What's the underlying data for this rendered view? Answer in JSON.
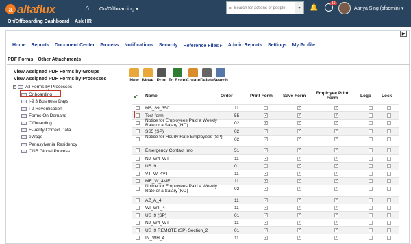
{
  "brand": "altaflux",
  "topbar": {
    "module": "On/Offboarding",
    "search_placeholder": "Search for actions or people",
    "notif_count": "16",
    "user": "Aanya Sing (sfadmin)"
  },
  "secondary": [
    "On/Offboarding Dashboard",
    "Ask HR"
  ],
  "mainnav": [
    "Home",
    "Reports",
    "Document Center",
    "Process",
    "Notifications",
    "Security",
    "Reference Files ▸",
    "Admin Reports",
    "Settings",
    "My Profile"
  ],
  "subtabs": [
    "PDF Forms",
    "Other Attachments"
  ],
  "left": {
    "group_title": "View Assigned PDF Forms by Groups",
    "process_title": "View Assigned PDF Forms by Processes",
    "root": "All Forms by Processes",
    "items": [
      "Onboarding",
      "I-9 3 Business Days",
      "I-9 Reverification",
      "Forms On Demand",
      "Offboarding",
      "E-Verify Correct Data",
      "eWage",
      "Pennsylvania Residency",
      "ONB Global Process"
    ]
  },
  "toolbar": [
    {
      "label": "New",
      "icon": "folder-new-icon",
      "color": "#e8a83a"
    },
    {
      "label": "Move",
      "icon": "folder-move-icon",
      "color": "#e8a83a"
    },
    {
      "label": "Print",
      "icon": "printer-icon",
      "color": "#555555"
    },
    {
      "label": "To Excel",
      "icon": "excel-icon",
      "color": "#2e7d32"
    },
    {
      "label": "Create",
      "icon": "create-doc-icon",
      "color": "#d98c2b"
    },
    {
      "label": "Delete",
      "icon": "delete-icon",
      "color": "#666666"
    },
    {
      "label": "Search",
      "icon": "search-doc-icon",
      "color": "#5577aa"
    }
  ],
  "columns": {
    "name": "Name",
    "order": "Order",
    "print": "Print Form",
    "save": "Save Form",
    "emp_print": "Employee Print Form",
    "logo": "Logo",
    "lock": "Lock"
  },
  "rows": [
    {
      "name": "MS_89_350",
      "order": "11",
      "print": false,
      "save": true,
      "emp": true,
      "logo": false,
      "lock": false
    },
    {
      "name": "Test form",
      "order": "55",
      "print": true,
      "save": true,
      "emp": true,
      "logo": false,
      "lock": false
    },
    {
      "name": "Notice for Employees Paid a Weekly Rate or a Salary (HC)",
      "order": "02",
      "print": true,
      "save": true,
      "emp": true,
      "logo": false,
      "lock": false
    },
    {
      "name": "SS5 (SP)",
      "order": "02",
      "print": true,
      "save": true,
      "emp": true,
      "logo": false,
      "lock": false
    },
    {
      "name": "Notice for Hourly Rate Employees (SP)",
      "order": "02",
      "print": true,
      "save": true,
      "emp": true,
      "logo": false,
      "lock": false
    },
    {
      "name": "Emergency Contact Info",
      "order": "51",
      "print": true,
      "save": true,
      "emp": true,
      "logo": false,
      "lock": false
    },
    {
      "name": "NJ_W4_WT",
      "order": "11",
      "print": true,
      "save": true,
      "emp": true,
      "logo": false,
      "lock": false
    },
    {
      "name": "US I9",
      "order": "01",
      "print": false,
      "save": true,
      "emp": true,
      "logo": false,
      "lock": false
    },
    {
      "name": "VT_W_4VT",
      "order": "11",
      "print": true,
      "save": true,
      "emp": true,
      "logo": false,
      "lock": false
    },
    {
      "name": "ME_W_4ME",
      "order": "11",
      "print": true,
      "save": true,
      "emp": true,
      "logo": false,
      "lock": false
    },
    {
      "name": "Notice for Employees Paid a Weekly Rate or a Salary (KO)",
      "order": "02",
      "print": true,
      "save": true,
      "emp": true,
      "logo": false,
      "lock": false
    },
    {
      "name": "AZ_A_4",
      "order": "11",
      "print": true,
      "save": true,
      "emp": true,
      "logo": false,
      "lock": false
    },
    {
      "name": "WI_WT_4",
      "order": "11",
      "print": true,
      "save": true,
      "emp": true,
      "logo": false,
      "lock": false
    },
    {
      "name": "US I9 (SP)",
      "order": "01",
      "print": true,
      "save": true,
      "emp": true,
      "logo": false,
      "lock": false
    },
    {
      "name": "NJ_W4_WT",
      "order": "11",
      "print": true,
      "save": true,
      "emp": true,
      "logo": false,
      "lock": false
    },
    {
      "name": "US I9 REMOTE (SP) Section_2",
      "order": "01",
      "print": true,
      "save": true,
      "emp": true,
      "logo": false,
      "lock": false
    },
    {
      "name": "IN_WH_4",
      "order": "11",
      "print": true,
      "save": true,
      "emp": true,
      "logo": false,
      "lock": false
    }
  ]
}
